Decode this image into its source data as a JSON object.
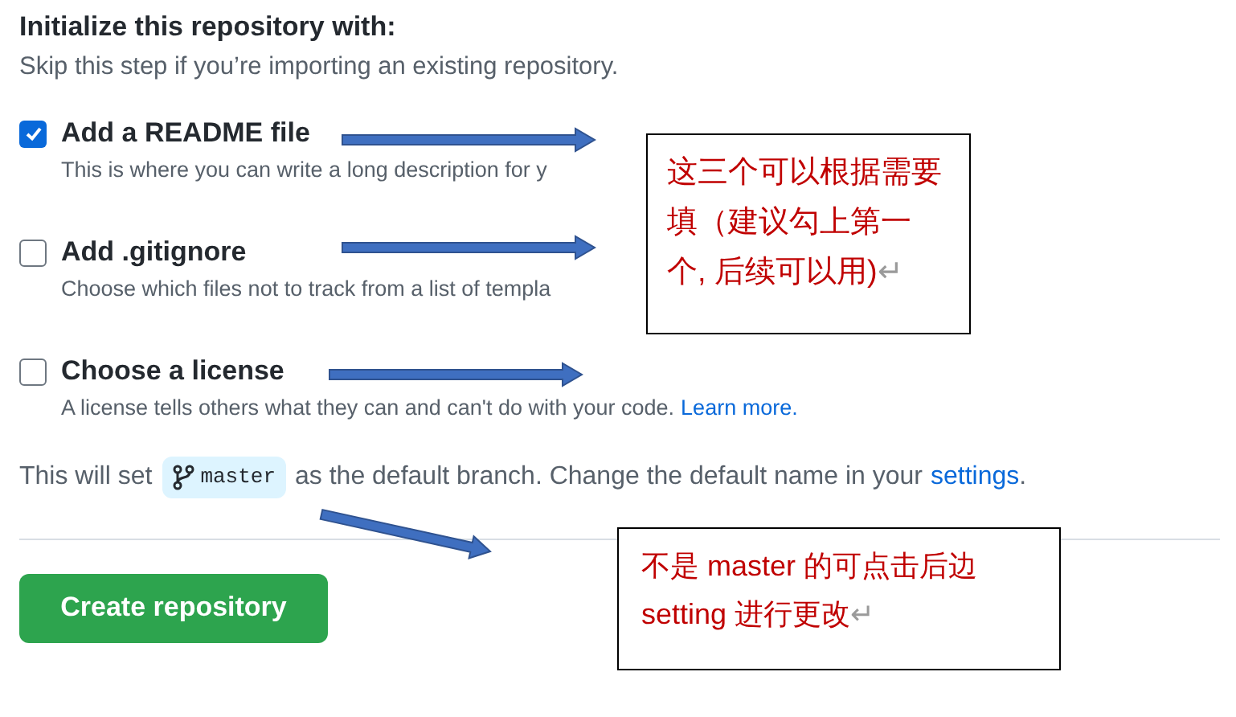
{
  "heading": "Initialize this repository with:",
  "subheading": "Skip this step if you’re importing an existing repository.",
  "options": [
    {
      "label": "Add a README file",
      "checked": true,
      "description": "This is where you can write a long description for y"
    },
    {
      "label": "Add .gitignore",
      "checked": false,
      "description": "Choose which files not to track from a list of templa"
    },
    {
      "label": "Choose a license",
      "checked": false,
      "description": "A license tells others what they can and can't do with your code.",
      "link": "Learn more."
    }
  ],
  "default_branch": {
    "before": "This will set",
    "branch": "master",
    "after": "as the default branch. Change the default name in your",
    "link": "settings",
    "end": "."
  },
  "button": "Create repository",
  "notes": [
    {
      "text": "这三个可以根据需要填（建议勾上第一个, 后续可以用)",
      "mark": "↵"
    },
    {
      "text": "不是 master 的可点击后边setting 进行更改",
      "mark": "↵"
    }
  ]
}
